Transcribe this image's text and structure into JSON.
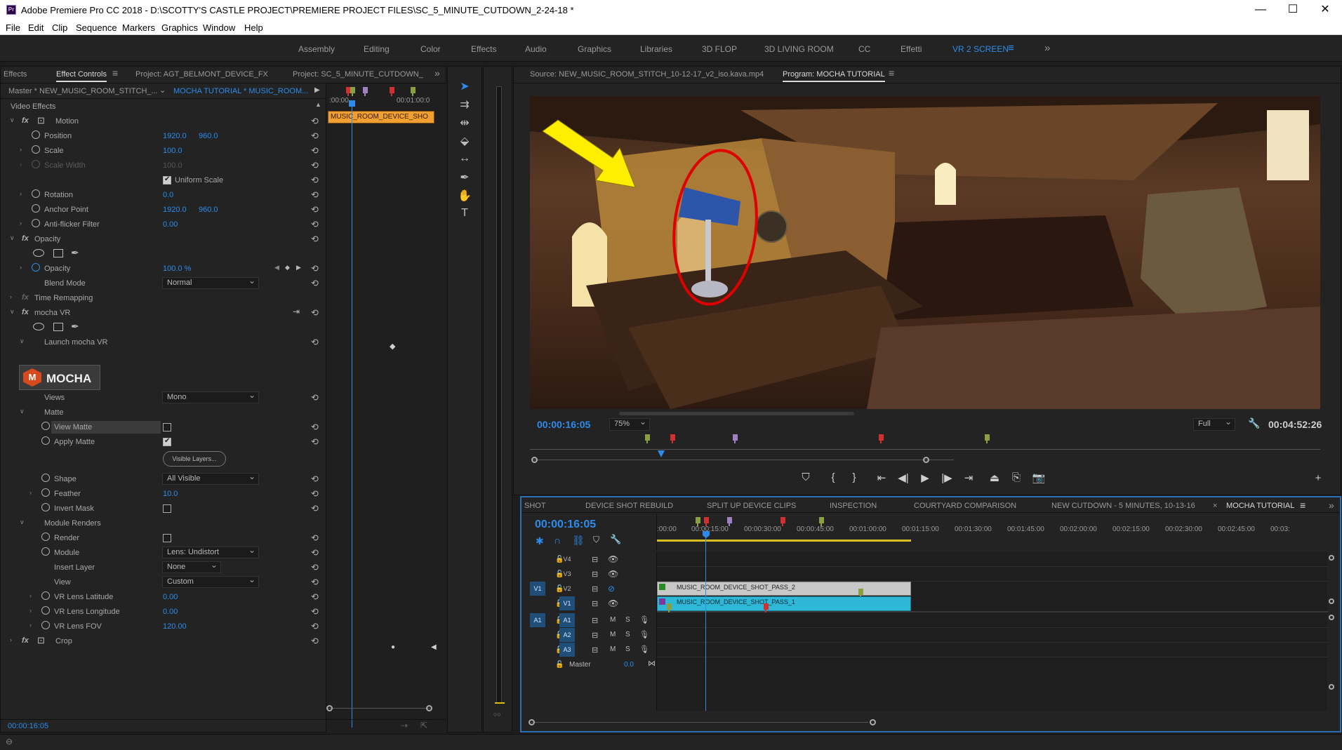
{
  "window": {
    "title": "Adobe Premiere Pro CC 2018 - D:\\SCOTTY'S CASTLE PROJECT\\PREMIERE PROJECT FILES\\SC_5_MINUTE_CUTDOWN_2-24-18 *",
    "app_badge": "Pr"
  },
  "menu": [
    "File",
    "Edit",
    "Clip",
    "Sequence",
    "Markers",
    "Graphics",
    "Window",
    "Help"
  ],
  "workspaces": [
    "Assembly",
    "Editing",
    "Color",
    "Effects",
    "Audio",
    "Graphics",
    "Libraries",
    "3D FLOP",
    "3D LIVING ROOM",
    "CC",
    "Effetti",
    "VR 2 SCREEN"
  ],
  "workspace_active": "VR 2 SCREEN",
  "left_tabs": [
    "Effects",
    "Effect Controls",
    "Project: AGT_BELMONT_DEVICE_FX",
    "Project: SC_5_MINUTE_CUTDOWN_"
  ],
  "left_tab_active": "Effect Controls",
  "effect_controls": {
    "master_label": "Master * NEW_MUSIC_ROOM_STITCH_...",
    "clip_label": "MOCHA TUTORIAL * MUSIC_ROOM...",
    "mini_timeline_start": ":00:00",
    "mini_timeline_end": "00:01:00:0",
    "clip_bar_label": "MUSIC_ROOM_DEVICE_SHO",
    "section_title": "Video Effects",
    "motion": {
      "name": "Motion",
      "position_label": "Position",
      "position_x": "1920.0",
      "position_y": "960.0",
      "scale_label": "Scale",
      "scale": "100.0",
      "scale_width_label": "Scale Width",
      "scale_width": "100.0",
      "uniform_scale_label": "Uniform Scale",
      "rotation_label": "Rotation",
      "rotation": "0.0",
      "anchor_label": "Anchor Point",
      "anchor_x": "1920.0",
      "anchor_y": "960.0",
      "antiflicker_label": "Anti-flicker Filter",
      "antiflicker": "0.00"
    },
    "opacity": {
      "name": "Opacity",
      "opacity_label": "Opacity",
      "opacity": "100.0 %",
      "blend_label": "Blend Mode",
      "blend": "Normal"
    },
    "time_remapping": "Time Remapping",
    "mocha": {
      "name": "mocha VR",
      "launch_label": "Launch mocha VR",
      "logo_text": "MOCHA",
      "views_label": "Views",
      "views": "Mono",
      "matte_label": "Matte",
      "view_matte_label": "View Matte",
      "apply_matte_label": "Apply Matte",
      "visible_layers_btn": "Visible Layers...",
      "shape_label": "Shape",
      "shape": "All Visible",
      "feather_label": "Feather",
      "feather": "10.0",
      "invert_label": "Invert Mask",
      "module_renders_label": "Module Renders",
      "render_label": "Render",
      "module_label": "Module",
      "module": "Lens: Undistort",
      "insert_label": "Insert Layer",
      "insert": "None",
      "view_label": "View",
      "view": "Custom",
      "lat_label": "VR Lens Latitude",
      "lat": "0.00",
      "long_label": "VR Lens Longitude",
      "long": "0.00",
      "fov_label": "VR Lens FOV",
      "fov": "120.00"
    },
    "crop": "Crop",
    "footer_time": "00:00:16:05"
  },
  "monitor": {
    "source_tab": "Source: NEW_MUSIC_ROOM_STITCH_10-12-17_v2_iso.kava.mp4",
    "program_tab": "Program: MOCHA TUTORIAL",
    "timecode": "00:00:16:05",
    "zoom": "75%",
    "quality": "Full",
    "duration": "00:04:52:26"
  },
  "timeline": {
    "tabs": [
      "SHOT",
      "DEVICE SHOT REBUILD",
      "SPLIT UP DEVICE CLIPS",
      "INSPECTION",
      "COURTYARD COMPARISON",
      "NEW CUTDOWN - 5 MINUTES, 10-13-16",
      "MOCHA TUTORIAL"
    ],
    "active_tab": "MOCHA TUTORIAL",
    "timecode": "00:00:16:05",
    "ruler": [
      ":00:00",
      "00:00:15:00",
      "00:00:30:00",
      "00:00:45:00",
      "00:01:00:00",
      "00:01:15:00",
      "00:01:30:00",
      "00:01:45:00",
      "00:02:00:00",
      "00:02:15:00",
      "00:02:30:00",
      "00:02:45:00",
      "00:03:"
    ],
    "tracks_video": [
      "V4",
      "V3",
      "V2",
      "V1"
    ],
    "tracks_audio": [
      "A1",
      "A2",
      "A3"
    ],
    "source_v": "V1",
    "source_a": "A1",
    "master_label": "Master",
    "master_value": "0.0",
    "clip_v2": "MUSIC_ROOM_DEVICE_SHOT_PASS_2",
    "clip_v1": "MUSIC_ROOM_DEVICE_SHOT_PASS_1",
    "m_label": "M",
    "s_label": "S"
  },
  "colors": {
    "accent": "#2d8ceb",
    "clip_v1": "#2fb7d7",
    "clip_v2": "#c8c8c8",
    "clip_bar": "#f0a030",
    "arrow": "#ffee00",
    "ellipse": "#e00000"
  }
}
